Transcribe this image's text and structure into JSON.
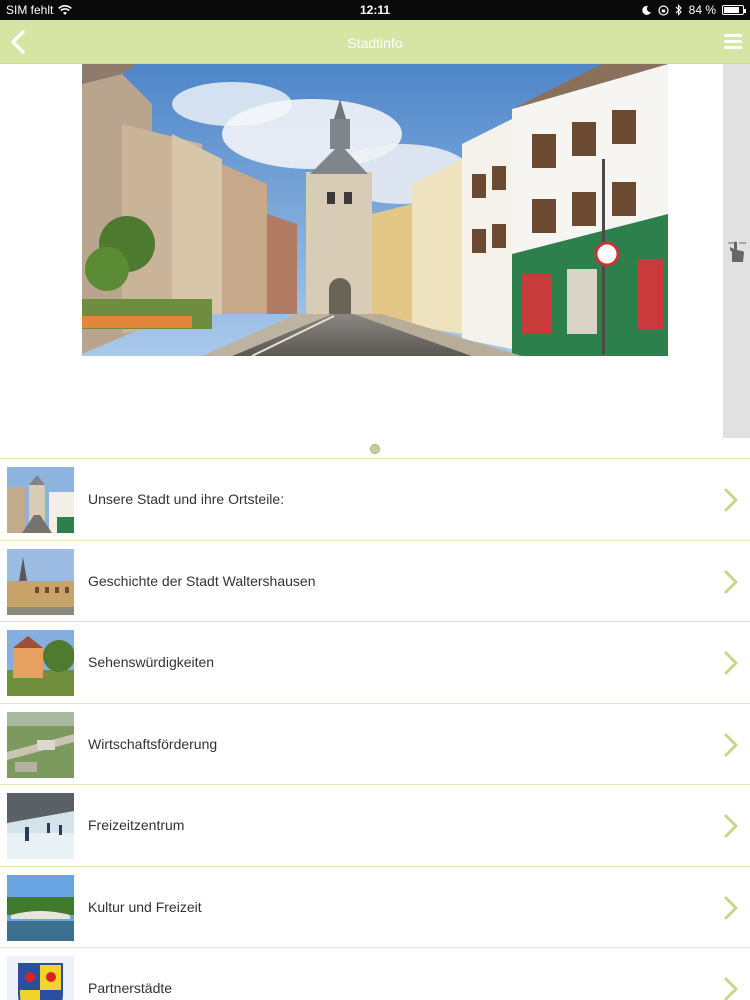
{
  "status": {
    "carrier": "SIM fehlt",
    "time": "12:11",
    "battery": "84 %",
    "battery_level": 0.84
  },
  "header": {
    "title": "Stadtinfo",
    "back_icon": "chevron-left-icon",
    "menu_icon": "hamburger-menu-icon"
  },
  "hero": {
    "image": "old-town-street-with-gate-tower-photo",
    "page_indicator_total": 1,
    "page_indicator_active": 1,
    "side_tab_icon": "swipe-hand-icon"
  },
  "menu": {
    "items": [
      {
        "label": "Unsere Stadt und ihre Ortsteile:",
        "thumb": "town-street-thumbnail"
      },
      {
        "label": "Geschichte der Stadt Waltershausen",
        "thumb": "historic-building-thumbnail"
      },
      {
        "label": "Sehenswürdigkeiten",
        "thumb": "castle-park-thumbnail"
      },
      {
        "label": "Wirtschaftsförderung",
        "thumb": "industrial-aerial-thumbnail"
      },
      {
        "label": "Freizeitzentrum",
        "thumb": "ice-rink-thumbnail"
      },
      {
        "label": "Kultur und Freizeit",
        "thumb": "bridge-river-thumbnail"
      },
      {
        "label": "Partnerstädte",
        "thumb": "coat-of-arms-thumbnail"
      }
    ]
  },
  "colors": {
    "header_bg": "#d6e4a4",
    "accent": "#b9cc74",
    "divider": "#dfe8b8"
  }
}
